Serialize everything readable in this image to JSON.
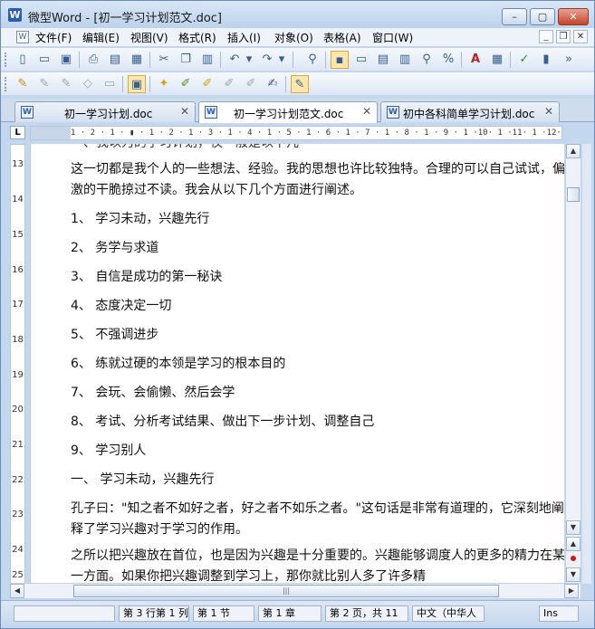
{
  "window": {
    "title": "微型Word - [初一学习计划范文.doc]",
    "app_icon_letter": "W",
    "controls": {
      "minimize": "–",
      "maximize": "▢",
      "close": "✕"
    }
  },
  "menubar": {
    "items": [
      {
        "label": "文件(F)"
      },
      {
        "label": "编辑(E)"
      },
      {
        "label": "视图(V)"
      },
      {
        "label": "格式(R)"
      },
      {
        "label": "插入(I)"
      },
      {
        "label": "对象(O)"
      },
      {
        "label": "表格(A)"
      },
      {
        "label": "窗口(W)"
      }
    ],
    "mdi_controls": {
      "minimize": "_",
      "restore": "❐",
      "close": "✕"
    }
  },
  "toolbar1": {
    "overflow": "»"
  },
  "tabs": [
    {
      "label": "初一学习计划.doc",
      "close": "✕",
      "active": false
    },
    {
      "label": "初一学习计划范文.doc",
      "close": "✕",
      "active": true
    },
    {
      "label": "初中各科简单学习计划.doc",
      "close": "✕",
      "active": false
    }
  ],
  "ruler": {
    "corner": "L",
    "ticks": "1 · 2 · 1 · ▮ · 1 · 2 · 1 · 3 · 1 · 4 · 1 · 5 · 1 · 6 · 1 · 7 · 1 · 8 · 1 · 9 · 1 ·10· 1 ·11· 1 ·12· 1 ·13· 1 ·14·",
    "vertical_numbers": [
      "13",
      "14",
      "15",
      "16",
      "17",
      "18",
      "19",
      "20",
      "21",
      "22",
      "23",
      "24",
      "25"
    ]
  },
  "document": {
    "paragraphs": [
      "一、我以为的学习计划，仅一般是以下几",
      "这一切都是我个人的一些想法、经验。我的思想也许比较独特。合理的可以自己试试，偏激的干脆掠过不读。我会从以下几个方面进行阐述。",
      "1、 学习未动，兴趣先行",
      "2、 务学与求道",
      "3、 自信是成功的第一秘诀",
      "4、 态度决定一切",
      "5、 不强调进步",
      "6、 练就过硬的本领是学习的根本目的",
      "7、 会玩、会偷懒、然后会学",
      "8、 考试、分析考试结果、做出下一步计划、调整自己",
      "9、 学习别人",
      "一、 学习未动，兴趣先行",
      "孔子曰：\"知之者不如好之者，好之者不如乐之者。\"这句话是非常有道理的，它深刻地阐释了学习兴趣对于学习的作用。",
      "之所以把兴趣放在首位，也是因为兴趣是十分重要的。兴趣能够调度人的更多的精力在某一方面。如果你把兴趣调整到学习上，那你就比别人多了许多精"
    ]
  },
  "scrollbar": {
    "up": "▲",
    "down": "▼",
    "left": "◀",
    "right": "▶",
    "prev_page": "▲",
    "next_page": "▼",
    "thumb_grip": "|||"
  },
  "statusbar": {
    "cells": [
      {
        "text": ""
      },
      {
        "text": "第 3 行第 1 列"
      },
      {
        "text": "第 1 节"
      },
      {
        "text": "第 1 章"
      },
      {
        "text": "第 2 页，共 11"
      },
      {
        "text": "中文（中华人"
      },
      {
        "text": "Ins"
      }
    ]
  }
}
